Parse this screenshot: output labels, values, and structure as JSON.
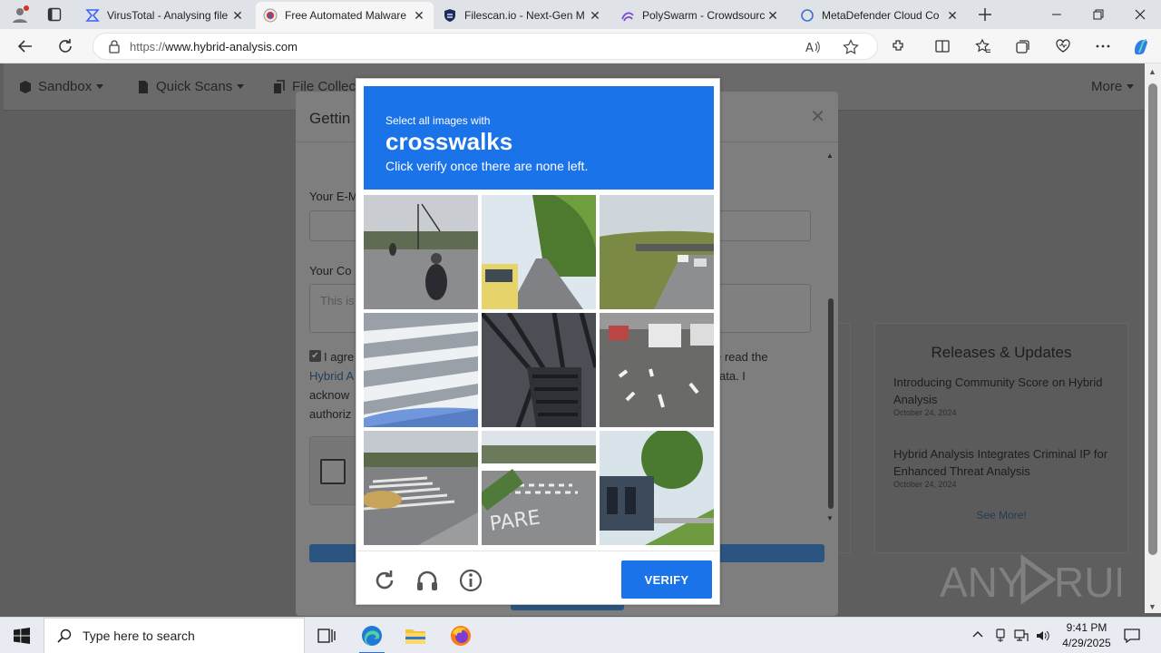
{
  "browser": {
    "tabs": [
      {
        "title": "VirusTotal - Analysing file",
        "icon": "virustotal-icon"
      },
      {
        "title": "Free Automated Malware",
        "icon": "hybrid-analysis-icon",
        "active": true
      },
      {
        "title": "Filescan.io - Next-Gen M",
        "icon": "filescan-icon"
      },
      {
        "title": "PolySwarm - Crowdsourc",
        "icon": "polyswarm-icon"
      },
      {
        "title": "MetaDefender Cloud Co",
        "icon": "loading-icon"
      }
    ],
    "url_prefix": "https://",
    "url_host": "www.hybrid-analysis.com"
  },
  "site": {
    "nav": {
      "sandbox": "Sandbox",
      "quick_scans": "Quick Scans",
      "file_collections": "File Collec",
      "more": "More"
    },
    "releases": {
      "title": "Releases & Updates",
      "items": [
        {
          "title": "Introducing Community Score on Hybrid Analysis",
          "date": "October 24, 2024"
        },
        {
          "title": "Hybrid Analysis Integrates Criminal IP for Enhanced Threat Analysis",
          "date": "October 24, 2024"
        }
      ],
      "see_more": "See More!"
    },
    "watermark": "ANY RUN"
  },
  "modal": {
    "title": "Gettin",
    "email_label": "Your E-M",
    "comment_label": "Your Co",
    "comment_placeholder": "This is",
    "agree_lines": [
      "I agre",
      "Hybrid A",
      "acknow",
      "authoriz"
    ],
    "agree_right": [
      "e read the",
      "ata. I"
    ],
    "agree_checked": true
  },
  "captcha": {
    "instruction": "Select all images with",
    "target": "crosswalks",
    "hint": "Click verify once there are none left.",
    "verify_label": "VERIFY",
    "accent": "#1a73e8"
  },
  "taskbar": {
    "search_placeholder": "Type here to search",
    "time": "9:41 PM",
    "date": "4/29/2025"
  }
}
